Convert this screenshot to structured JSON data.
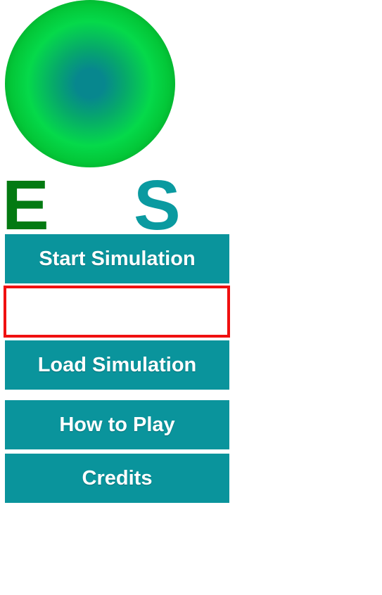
{
  "logo": {
    "left_letter": "E",
    "right_letter": "S"
  },
  "menu": {
    "start_label": "Start Simulation",
    "load_label": "Load Simulation",
    "howto_label": "How to Play",
    "credits_label": "Credits"
  },
  "colors": {
    "button_bg": "#0a949c",
    "button_text": "#ffffff",
    "letter_e": "#037a12",
    "letter_s": "#0a9aa0",
    "highlight_border": "#f01010"
  }
}
